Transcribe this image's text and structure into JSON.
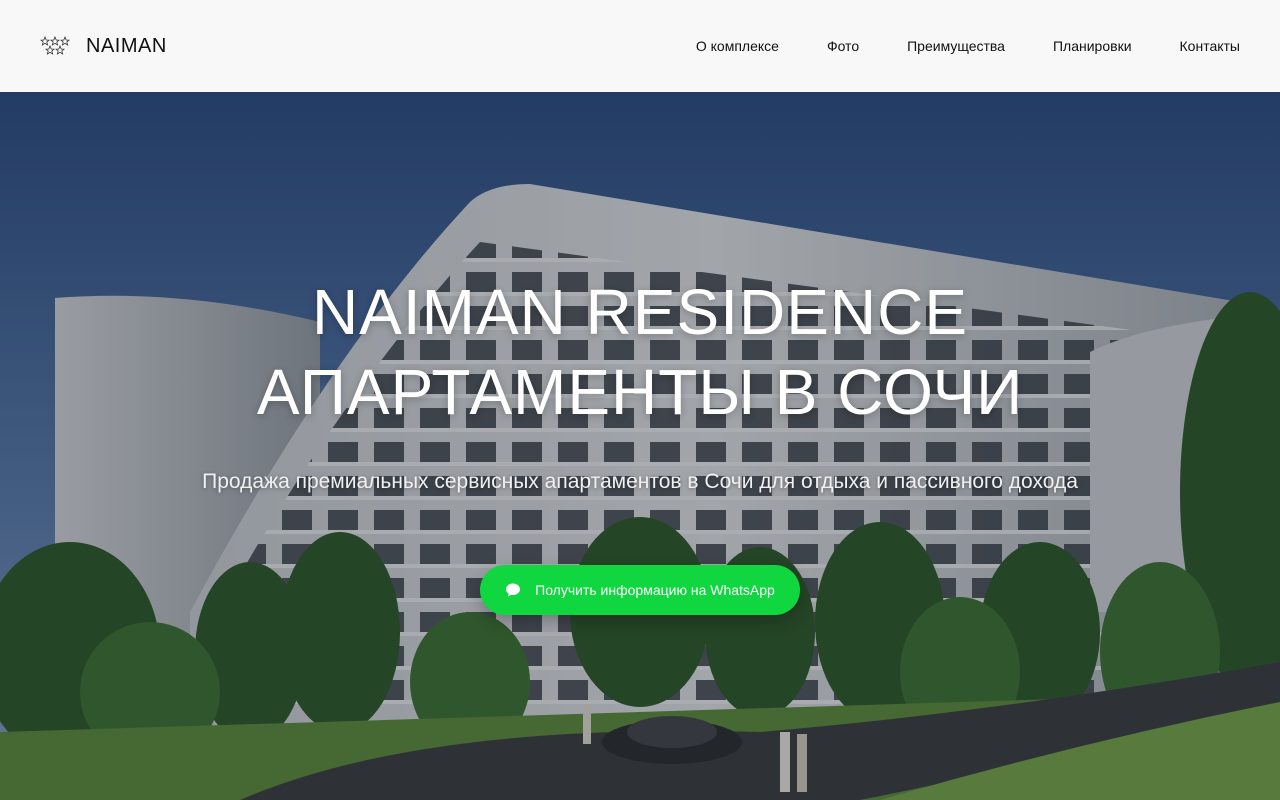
{
  "brand": {
    "name": "NAIMAN",
    "logo_icon": "stars-logo-icon"
  },
  "nav": {
    "items": [
      {
        "label": "О комплексе"
      },
      {
        "label": "Фото"
      },
      {
        "label": "Преимущества"
      },
      {
        "label": "Планировки"
      },
      {
        "label": "Контакты"
      }
    ]
  },
  "hero": {
    "title_line1": "NAIMAN RESIDENCE",
    "title_line2": "АПАРТАМЕНТЫ В СОЧИ",
    "subtitle": "Продажа премиальных сервисных апартаментов в Сочи для отдыха и пассивного дохода",
    "cta_label": "Получить информацию на WhatsApp",
    "cta_icon": "chat-bubble-icon"
  },
  "colors": {
    "header_bg": "#f8f8f8",
    "cta_green": "#10d640",
    "text_dark": "#111111",
    "hero_text": "#ffffff"
  }
}
